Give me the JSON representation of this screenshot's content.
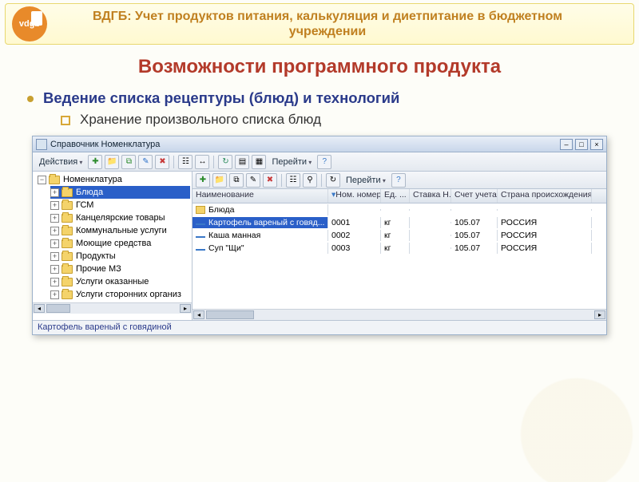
{
  "banner": {
    "logo_text": "vdgb",
    "title": "ВДГБ: Учет продуктов питания, калькуляция и диетпитание в бюджетном учреждении"
  },
  "heading": "Возможности программного продукта",
  "bullets": {
    "b1": "Ведение списка рецептуры (блюд) и технологий",
    "b2": "Хранение произвольного списка блюд"
  },
  "window": {
    "title": "Справочник Номенклатура",
    "toolbar": {
      "actions_label": "Действия",
      "goto_label": "Перейти"
    },
    "tree": {
      "root": "Номенклатура",
      "items": [
        "Блюда",
        "ГСМ",
        "Канцелярские товары",
        "Коммунальные услуги",
        "Моющие средства",
        "Продукты",
        "Прочие МЗ",
        "Услуги оказанные",
        "Услуги сторонних организ"
      ]
    },
    "grid": {
      "columns": {
        "name": "Наименование",
        "num": "Ном. номер",
        "ed": "Ед. ...",
        "stavka": "Ставка Н...",
        "schet": "Счет учета",
        "country": "Страна происхождения"
      },
      "folder_row": "Блюда",
      "rows": [
        {
          "name": "Картофель вареный с говяд...",
          "num": "0001",
          "ed": "кг",
          "stavka": "",
          "schet": "105.07",
          "country": "РОССИЯ"
        },
        {
          "name": "Каша манная",
          "num": "0002",
          "ed": "кг",
          "stavka": "",
          "schet": "105.07",
          "country": "РОССИЯ"
        },
        {
          "name": "Суп \"Щи\"",
          "num": "0003",
          "ed": "кг",
          "stavka": "",
          "schet": "105.07",
          "country": "РОССИЯ"
        }
      ]
    },
    "status": "Картофель вареный с говядиной"
  }
}
